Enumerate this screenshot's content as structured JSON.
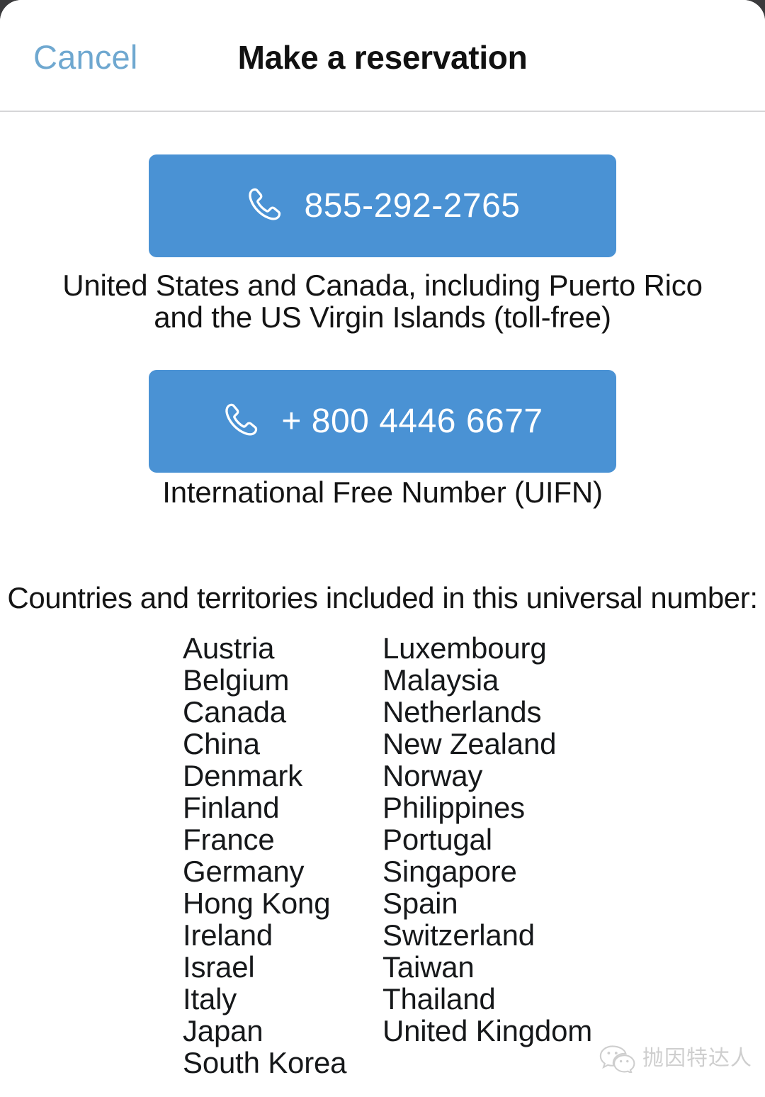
{
  "header": {
    "cancel_label": "Cancel",
    "title": "Make a reservation",
    "cancel_color": "#6fa8d0"
  },
  "call_options": [
    {
      "icon": "phone-icon",
      "number": "855-292-2765",
      "caption": "United States and Canada, including Puerto Rico and the US Virgin Islands (toll-free)",
      "color": "#4a92d4"
    },
    {
      "icon": "phone-icon",
      "number": "+ 800 4446 6677",
      "caption": "International Free Number (UIFN)",
      "color": "#4a92d4"
    }
  ],
  "countries_section": {
    "heading": "Countries and territories included in this universal number:",
    "left_column": [
      "Austria",
      "Belgium",
      "Canada",
      "China",
      "Denmark",
      "Finland",
      "France",
      "Germany",
      "Hong Kong",
      "Ireland",
      "Israel",
      "Italy",
      "Japan",
      "South Korea"
    ],
    "right_column": [
      "Luxembourg",
      "Malaysia",
      "Netherlands",
      "New Zealand",
      "Norway",
      "Philippines",
      "Portugal",
      "Singapore",
      "Spain",
      "Switzerland",
      "Taiwan",
      "Thailand",
      "United Kingdom"
    ]
  },
  "watermark": {
    "icon": "wechat-icon",
    "text": "抛因特达人"
  }
}
